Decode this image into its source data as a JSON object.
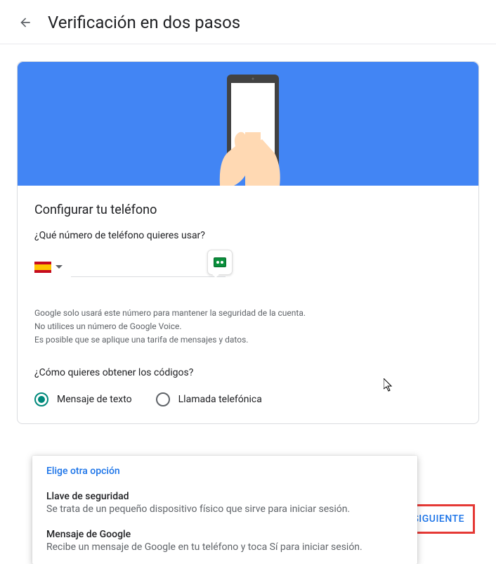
{
  "page_title": "Verificación en dos pasos",
  "section_title": "Configurar tu teléfono",
  "phone_question": "¿Qué número de teléfono quieres usar?",
  "disclaimer": {
    "line1": "Google solo usará este número para mantener la seguridad de la cuenta.",
    "line2": "No utilices un número de Google Voice.",
    "line3": "Es posible que se aplique una tarifa de mensajes y datos."
  },
  "code_question": "¿Cómo quieres obtener los códigos?",
  "radio_options": {
    "sms": "Mensaje de texto",
    "call": "Llamada telefónica"
  },
  "popup": {
    "title": "Elige otra opción",
    "items": [
      {
        "title": "Llave de seguridad",
        "desc": "Se trata de un pequeño dispositivo físico que sirve para iniciar sesión."
      },
      {
        "title": "Mensaje de Google",
        "desc": "Recibe un mensaje de Google en tu teléfono y toca Sí para iniciar sesión."
      }
    ]
  },
  "next_button": "SIGUIENTE",
  "country_flag": "spain"
}
